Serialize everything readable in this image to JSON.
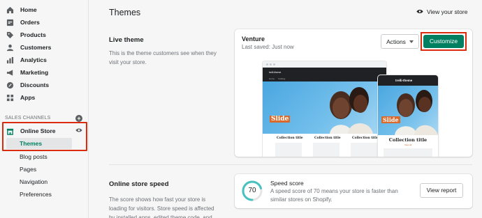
{
  "sidebar": {
    "items": [
      {
        "label": "Home",
        "icon": "home-icon"
      },
      {
        "label": "Orders",
        "icon": "orders-icon"
      },
      {
        "label": "Products",
        "icon": "tag-icon"
      },
      {
        "label": "Customers",
        "icon": "person-icon"
      },
      {
        "label": "Analytics",
        "icon": "bar-chart-icon"
      },
      {
        "label": "Marketing",
        "icon": "megaphone-icon"
      },
      {
        "label": "Discounts",
        "icon": "discount-icon"
      },
      {
        "label": "Apps",
        "icon": "apps-icon"
      }
    ],
    "sales_channels_label": "SALES CHANNELS",
    "online_store_label": "Online Store",
    "sub_items": [
      "Themes",
      "Blog posts",
      "Pages",
      "Navigation",
      "Preferences"
    ],
    "active_color": "#008060"
  },
  "header": {
    "title": "Themes",
    "view_store_label": "View your store"
  },
  "live_theme": {
    "section_title": "Live theme",
    "section_desc": "This is the theme customers see when they visit your store.",
    "theme_name": "Venture",
    "last_saved": "Last saved: Just now",
    "actions_label": "Actions",
    "customize_label": "Customize",
    "preview": {
      "logo_text": "trelli-theme",
      "desktop_logo": "trelli-theme",
      "nav_links": [
        "Home",
        "Catalog"
      ],
      "slide_label": "Slide",
      "collection_title": "Collection title",
      "view_all": "View all"
    }
  },
  "speed": {
    "section_title": "Online store speed",
    "section_desc": "The score shows how fast your store is loading for visitors. Store speed is affected by installed apps, edited theme code, and",
    "score": "70",
    "score_fraction": 0.7,
    "title": "Speed score",
    "text": "A speed score of 70 means your store is faster than similar stores on Shopify.",
    "report_label": "View report"
  },
  "colors": {
    "primary": "#008060",
    "highlight": "#d82c0d",
    "gauge": "#47c1bf"
  }
}
